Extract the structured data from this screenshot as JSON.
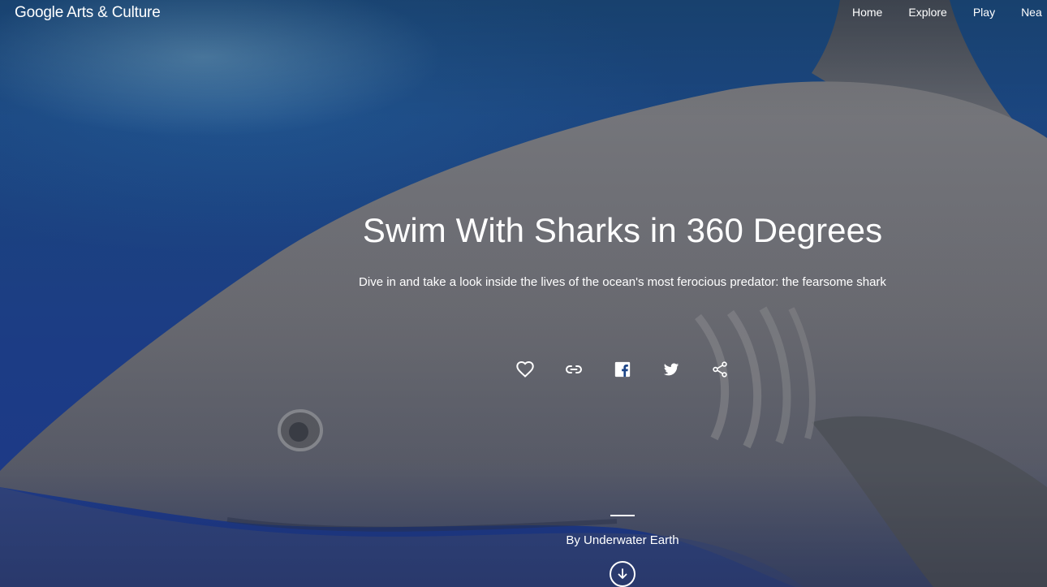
{
  "header": {
    "logo_text": "Google Arts & Culture",
    "nav": [
      {
        "label": "Home"
      },
      {
        "label": "Explore"
      },
      {
        "label": "Play"
      },
      {
        "label": "Nea"
      }
    ]
  },
  "hero": {
    "title": "Swim With Sharks in 360 Degrees",
    "subtitle": "Dive in and take a look inside the lives of the ocean's most ferocious predator: the fearsome shark",
    "actions": [
      {
        "icon": "heart-icon"
      },
      {
        "icon": "link-icon"
      },
      {
        "icon": "facebook-icon"
      },
      {
        "icon": "twitter-icon"
      },
      {
        "icon": "share-icon"
      }
    ],
    "byline": "By Underwater Earth",
    "scroll_icon": "arrow-down-icon"
  },
  "colors": {
    "ocean": "#1c4587",
    "shark": "#6f7078",
    "text": "#ffffff"
  }
}
